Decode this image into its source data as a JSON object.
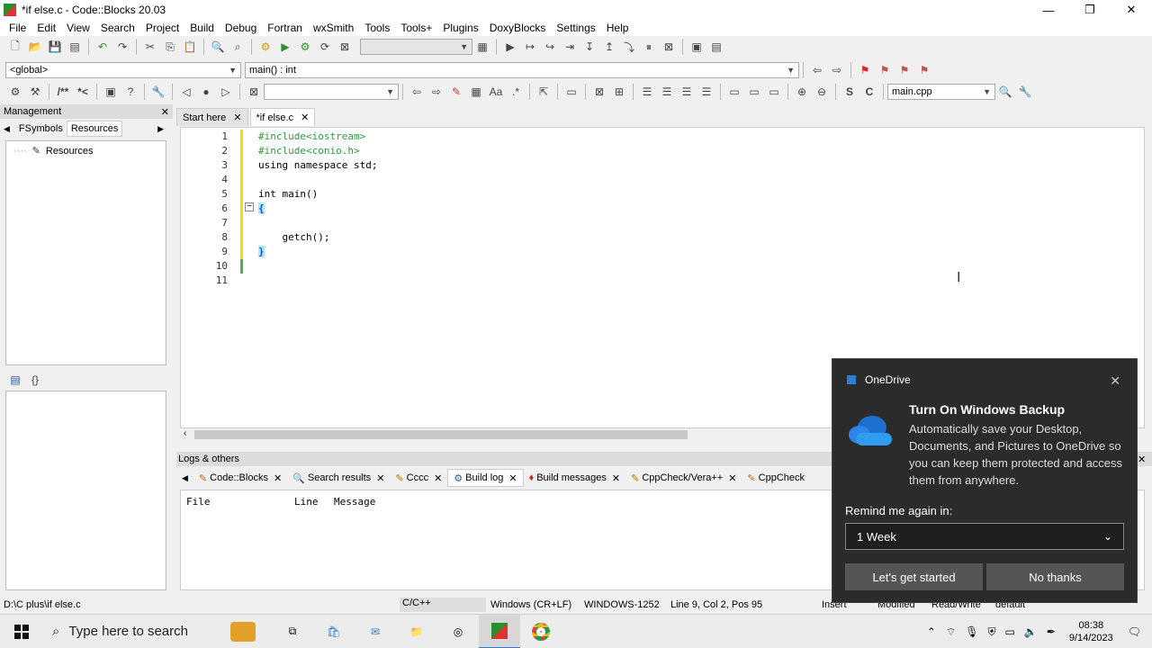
{
  "window": {
    "title": "*if else.c - Code::Blocks 20.03",
    "min": "—",
    "max": "❐",
    "close": "✕"
  },
  "menu": [
    "File",
    "Edit",
    "View",
    "Search",
    "Project",
    "Build",
    "Debug",
    "Fortran",
    "wxSmith",
    "Tools",
    "Tools+",
    "Plugins",
    "DoxyBlocks",
    "Settings",
    "Help"
  ],
  "toolbar2": {
    "scope": "<global>",
    "function": "main() : int"
  },
  "toolbar3": {
    "file_combo": "main.cpp"
  },
  "management": {
    "title": "Management",
    "close": "✕",
    "tabs": [
      "FSymbols",
      "Resources"
    ],
    "active_tab": "Resources",
    "tree_root": "Resources"
  },
  "editor": {
    "tabs": [
      {
        "label": "Start here",
        "close": "✕"
      },
      {
        "label": "*if else.c",
        "close": "✕"
      }
    ],
    "line_numbers": [
      "1",
      "2",
      "3",
      "4",
      "5",
      "6",
      "7",
      "8",
      "9",
      "10",
      "11"
    ],
    "code": [
      "#include<iostream>",
      "#include<conio.h>",
      "using namespace std;",
      "",
      "int main()",
      "{",
      "",
      "    getch();",
      "}",
      "",
      ""
    ]
  },
  "logs": {
    "title": "Logs & others",
    "tabs": [
      {
        "label": "Code::Blocks",
        "close": "✕"
      },
      {
        "label": "Search results",
        "close": "✕"
      },
      {
        "label": "Cccc",
        "close": "✕"
      },
      {
        "label": "Build log",
        "close": "✕"
      },
      {
        "label": "Build messages",
        "close": "✕"
      },
      {
        "label": "CppCheck/Vera++",
        "close": "✕"
      },
      {
        "label": "CppCheck",
        "close": ""
      }
    ],
    "columns": [
      "File",
      "Line",
      "Message"
    ]
  },
  "status": {
    "path": "D:\\C plus\\if else.c",
    "language": "C/C++",
    "eol": "Windows (CR+LF)",
    "encoding": "WINDOWS-1252",
    "position": "Line 9, Col 2, Pos 95",
    "mode": "Insert",
    "modified": "Modified",
    "access": "Read/Write",
    "profile": "default"
  },
  "onedrive": {
    "app": "OneDrive",
    "close": "✕",
    "title": "Turn On Windows Backup",
    "body": "Automatically save your Desktop, Documents, and Pictures to OneDrive so you can keep them protected and access them from anywhere.",
    "remind_label": "Remind me again in:",
    "remind_value": "1 Week",
    "primary_button": "Let's get started",
    "secondary_button": "No thanks"
  },
  "taskbar": {
    "search_placeholder": "Type here to search",
    "time": "08:38",
    "date": "9/14/2023"
  },
  "colors": {
    "toast_bg": "#2b2b2b",
    "preprocessor": "#2e9e3e",
    "brace_highlight": "#a0f0f0"
  }
}
